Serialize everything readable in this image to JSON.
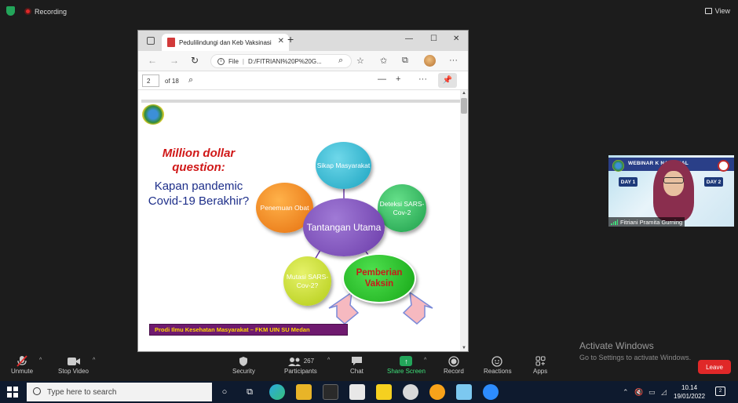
{
  "zoom": {
    "recording_label": "Recording",
    "view_label": "View",
    "toolbar": {
      "unmute": "Unmute",
      "stop_video": "Stop Video",
      "security": "Security",
      "participants": "Participants",
      "participants_count": "267",
      "chat": "Chat",
      "share_screen": "Share Screen",
      "record": "Record",
      "reactions": "Reactions",
      "apps": "Apps",
      "leave": "Leave"
    },
    "participant_video": {
      "name": "Fitriani Pramita Gurning",
      "banner": "WEBINAR K        NASIONAL",
      "day1": "DAY 1",
      "day2": "DAY 2"
    }
  },
  "browser": {
    "tab_title": "Pedulilindungi dan Keb Vaksinasi",
    "url_scheme": "File",
    "url": "D:/FITRIANI%20P%20G...",
    "pdf": {
      "current_page": "2",
      "total_pages": "of 18"
    }
  },
  "slide": {
    "question_red": "Million dollar question:",
    "question_blue": "Kapan pandemic Covid-19 Berakhir?",
    "center": "Tantangan Utama",
    "bubbles": {
      "sikap": "Sikap Masyarakat",
      "deteksi": "Deteksi SARS-Cov-2",
      "penemuan": "Penemuan Obat",
      "mutasi": "Mutasi SARS-Cov-2?",
      "vaksin": "Pemberian Vaksin"
    },
    "footer": "Prodi Ilmu Kesehatan Masyarakat – FKM UIN SU Medan"
  },
  "watermark": {
    "title": "Activate Windows",
    "subtitle": "Go to Settings to activate Windows."
  },
  "taskbar": {
    "search_placeholder": "Type here to search",
    "time": "10.14",
    "date": "19/01/2022",
    "notifications": "2"
  },
  "colors": {
    "zoom_bg": "#1c1c1c",
    "share_green": "#23a55a",
    "leave_red": "#e02828",
    "slide_red": "#d01818",
    "slide_blue": "#1e2f8a",
    "footer_purple": "#6f1a6f",
    "footer_text": "#ffd600"
  }
}
